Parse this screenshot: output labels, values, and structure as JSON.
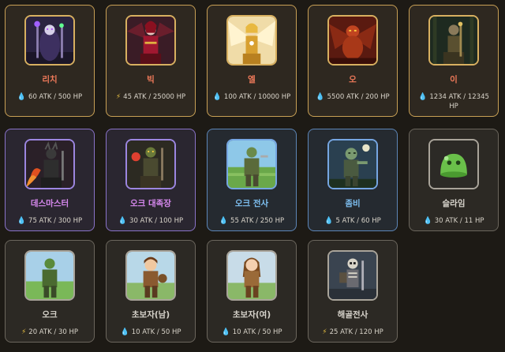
{
  "cards": [
    {
      "name": "리치",
      "stat": "60 ATK / 500 HP",
      "icon": "water-drop-icon"
    },
    {
      "name": "빅",
      "stat": "45 ATK / 25000 HP",
      "icon": "lightning-icon"
    },
    {
      "name": "엘",
      "stat": "100 ATK / 10000 HP",
      "icon": "water-drop-icon"
    },
    {
      "name": "오",
      "stat": "5500 ATK / 200 HP",
      "icon": "gold-drop-icon"
    },
    {
      "name": "이",
      "stat": "1234 ATK / 12345 HP",
      "icon": "water-drop-icon"
    },
    {
      "name": "데스마스터",
      "stat": "75 ATK / 300 HP",
      "icon": "gold-drop-icon"
    },
    {
      "name": "오크 대족장",
      "stat": "30 ATK / 100 HP",
      "icon": "water-drop-icon"
    },
    {
      "name": "오크 전사",
      "stat": "55 ATK / 250 HP",
      "icon": "gold-drop-icon"
    },
    {
      "name": "좀비",
      "stat": "5 ATK / 60 HP",
      "icon": "gold-drop-icon"
    },
    {
      "name": "슬라임",
      "stat": "30 ATK / 11 HP",
      "icon": "water-drop-icon"
    },
    {
      "name": "오크",
      "stat": "20 ATK / 30 HP",
      "icon": "lightning-icon"
    },
    {
      "name": "초보자(남)",
      "stat": "10 ATK / 50 HP",
      "icon": "gold-drop-icon"
    },
    {
      "name": "초보자(여)",
      "stat": "10 ATK / 50 HP",
      "icon": "water-drop-icon"
    },
    {
      "name": "해골전사",
      "stat": "25 ATK / 120 HP",
      "icon": "lightning-icon"
    }
  ],
  "colors": {
    "background": "#1d1a15",
    "legendary_border": "#c8a055",
    "epic_border": "#8a73c9",
    "rare_border": "#5d86b8",
    "common_border": "#6b665d"
  }
}
